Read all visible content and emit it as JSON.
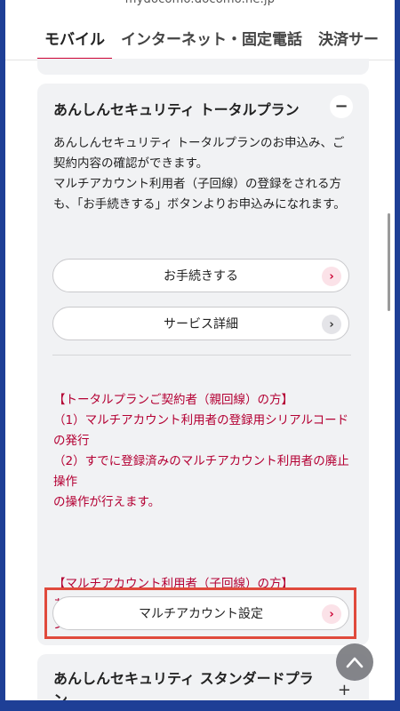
{
  "browser": {
    "url": "mydocomo.docomo.ne.jp"
  },
  "tabs": [
    {
      "label": "モバイル",
      "active": true
    },
    {
      "label": "インターネット・固定電話"
    },
    {
      "label": "決済サー"
    }
  ],
  "card": {
    "title": "あんしんセキュリティ トータルプラン",
    "toggle": "−",
    "description": "あんしんセキュリティ トータルプランのお申込み、ご契約内容の確認ができます。\nマルチアカウント利用者（子回線）の登録をされる方も、「お手続きする」ボタンよりお申込みになれます。",
    "buttons": {
      "procedure_label": "お手続きする",
      "service_detail_label": "サービス詳細",
      "multi_account_label": "マルチアカウント設定"
    },
    "notice_parent": "【トータルプランご契約者（親回線）の方】\n（1）マルチアカウント利用者の登録用シリアルコードの発行\n（2）すでに登録済みのマルチアカウント利用者の廃止操作\nの操作が行えます。",
    "notice_child": "【マルチアカウント利用者（子回線）の方】\nあんしんセキュリティ トータルプランのマルチアカウント利用者の廃止操作が行えます。"
  },
  "card2": {
    "title": "あんしんセキュリティ スタンダードプラン",
    "toggle": "+"
  },
  "icons": {
    "chevron_right": "›",
    "scroll_top": "chevron-up-icon"
  },
  "colors": {
    "accent": "#cc0033",
    "notice_text": "#b40033",
    "highlight_border": "#e04a3c",
    "card_bg": "#f1f2f4",
    "frame_bg": "#1e3f96"
  }
}
